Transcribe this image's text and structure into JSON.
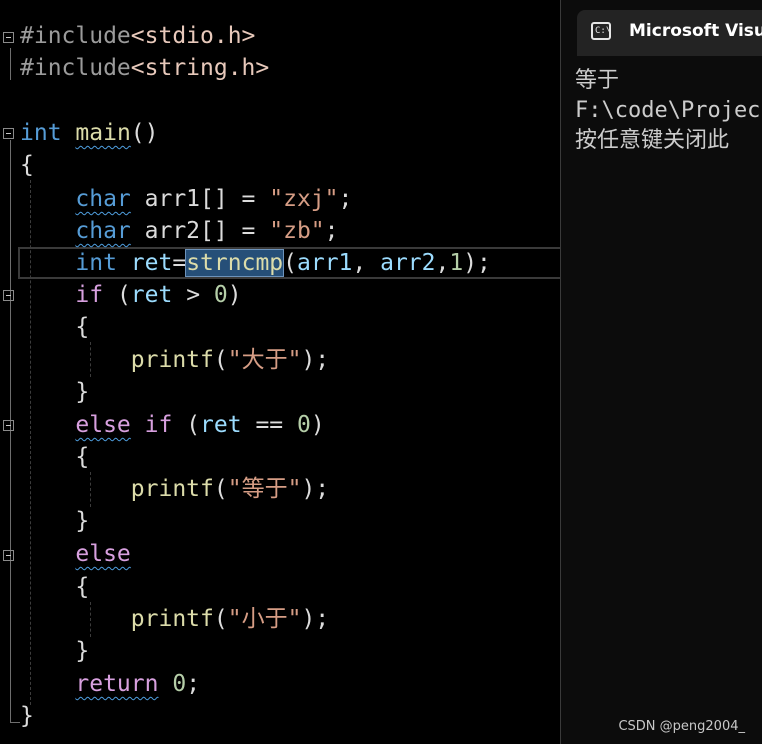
{
  "editor": {
    "include1": {
      "directive": "#include",
      "header": "<stdio.h>"
    },
    "include2": {
      "directive": "#include",
      "header": "<string.h>"
    },
    "main_sig": {
      "type": "int",
      "name": "main",
      "parens": "()"
    },
    "open_brace": "{",
    "decl1": {
      "type": "char",
      "rest": " arr1[] = ",
      "value": "\"zxj\"",
      "end": ";"
    },
    "decl2": {
      "type": "char",
      "rest": " arr2[] = ",
      "value": "\"zb\"",
      "end": ";"
    },
    "decl3": {
      "type": "int",
      "var": "ret",
      "eq": "=",
      "fn": "strncmp",
      "open": "(",
      "arg1": "arr1",
      "sep1": ", ",
      "arg2": "arr2",
      "sep2": ",",
      "num": "1",
      "close": ");"
    },
    "if1": {
      "kw": "if",
      "open": " (",
      "var": "ret",
      "op": " > ",
      "num": "0",
      "close": ")"
    },
    "block1": {
      "open": "{",
      "fn": "printf",
      "paren": "(",
      "str": "\"大于\"",
      "end": ");",
      "close": "}"
    },
    "elseif": {
      "kw1": "else",
      "kw2": "if",
      "open": " (",
      "var": "ret",
      "op": " == ",
      "num": "0",
      "close": ")"
    },
    "block2": {
      "open": "{",
      "fn": "printf",
      "paren": "(",
      "str": "\"等于\"",
      "end": ");",
      "close": "}"
    },
    "else_kw": "else",
    "block3": {
      "open": "{",
      "fn": "printf",
      "paren": "(",
      "str": "\"小于\"",
      "end": ");",
      "close": "}"
    },
    "ret": {
      "kw": "return",
      "num": "0",
      "end": ";"
    },
    "close_brace": "}"
  },
  "console": {
    "tab_title": "Microsoft Visual",
    "tab_icon": "console-icon",
    "tab_icon_glyph": "C:\\",
    "lines": [
      "等于",
      "F:\\code\\Projec",
      "按任意键关闭此"
    ]
  },
  "watermark": "CSDN @peng2004_",
  "colors": {
    "keyword": "#569cd6",
    "flow_keyword": "#d8a0df",
    "function": "#dcdcaa",
    "variable": "#9cdcfe",
    "string": "#d69d85",
    "number": "#b5cea8",
    "selection": "#264f78"
  }
}
